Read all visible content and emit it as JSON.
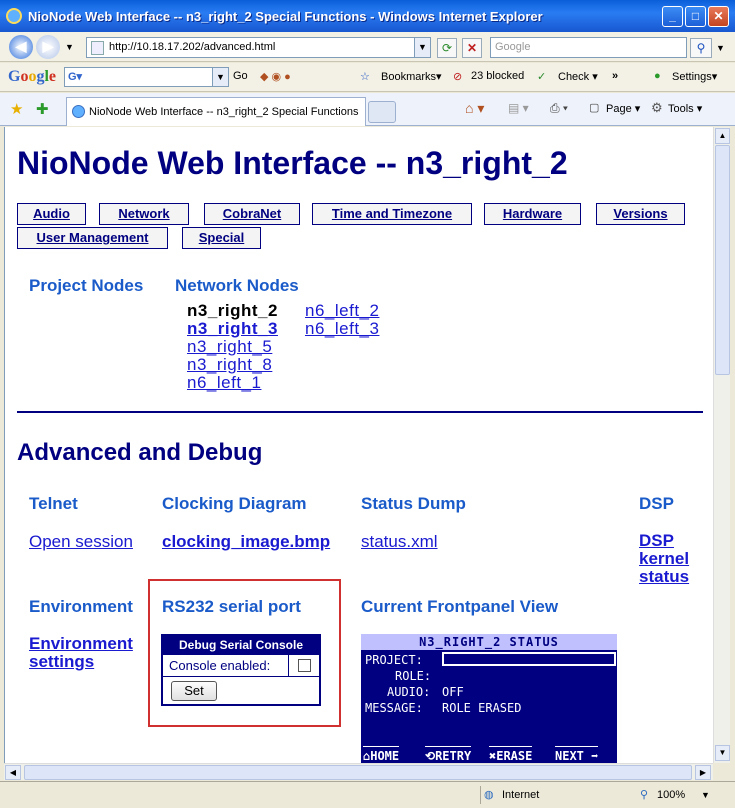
{
  "window": {
    "title": "NioNode Web Interface -- n3_right_2 Special Functions - Windows Internet Explorer",
    "minimize": "_",
    "maximize": "□",
    "close": "✕"
  },
  "address": {
    "url": "http://10.18.17.202/advanced.html",
    "search_placeholder": "Google"
  },
  "google_toolbar": {
    "logo": "Google",
    "go": "Go",
    "bookmarks": "Bookmarks▾",
    "blocked": "23 blocked",
    "check": "Check ▾",
    "more": "»",
    "settings": "Settings▾"
  },
  "tab": {
    "label": "NioNode Web Interface -- n3_right_2 Special Functions",
    "page_menu": "Page ▾",
    "tools_menu": "Tools ▾"
  },
  "page": {
    "heading": "NioNode Web Interface -- n3_right_2",
    "nav": [
      "Audio",
      "Network",
      "CobraNet",
      "Time and Timezone",
      "Hardware",
      "Versions",
      "User Management",
      "Special"
    ],
    "project_nodes_heading": "Project Nodes",
    "network_nodes_heading": "Network Nodes",
    "nodes": {
      "current": "n3_right_2",
      "col1": [
        "n3_right_3",
        "n3_right_5",
        "n3_right_8",
        "n6_left_1"
      ],
      "col2": [
        "n6_left_2",
        "n6_left_3"
      ]
    },
    "advanced_heading": "Advanced and Debug",
    "telnet": {
      "heading": "Telnet",
      "link": "Open session"
    },
    "clocking": {
      "heading": "Clocking Diagram",
      "link": "clocking_image.bmp"
    },
    "status_dump": {
      "heading": "Status Dump",
      "link": "status.xml"
    },
    "dsp": {
      "heading": "DSP",
      "link_lines": [
        "DSP",
        "kernel",
        "status"
      ]
    },
    "environment": {
      "heading": "Environment",
      "link_lines": [
        "Environment",
        "settings"
      ]
    },
    "rs232": {
      "heading": "RS232 serial port",
      "console_title": "Debug Serial Console",
      "console_label": "Console enabled:",
      "console_enabled": false,
      "set_button": "Set"
    },
    "frontpanel": {
      "heading": "Current Frontpanel View",
      "lcd_title": "N3_RIGHT_2 STATUS",
      "lines": [
        {
          "label": "PROJECT:",
          "value": ""
        },
        {
          "label": "ROLE:",
          "value": ""
        },
        {
          "label": "AUDIO:",
          "value": "OFF"
        },
        {
          "label": "MESSAGE:",
          "value": "ROLE ERASED"
        }
      ],
      "buttons": [
        "HOME",
        "RETRY",
        "ERASE",
        "NEXT"
      ]
    }
  },
  "status": {
    "zone": "Internet",
    "zoom": "100%"
  }
}
